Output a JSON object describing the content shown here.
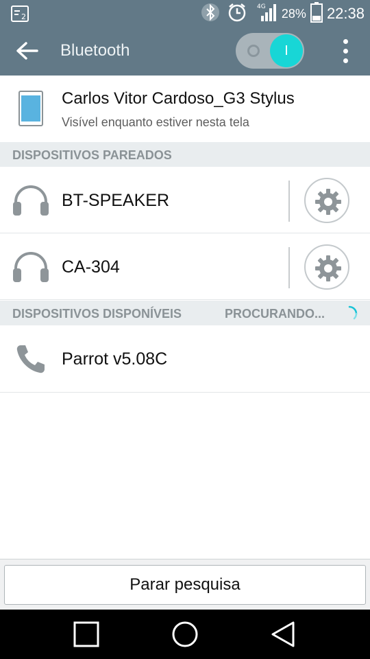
{
  "status_bar": {
    "battery_percent": "28%",
    "time": "22:38",
    "icons": [
      "notification-icon",
      "bluetooth-icon",
      "alarm-icon",
      "signal-icon",
      "battery-icon"
    ]
  },
  "app_bar": {
    "title": "Bluetooth",
    "toggle_on_glyph": "I",
    "toggle_state": "on",
    "accent": "#18d6d6",
    "bar_color": "#627987"
  },
  "this_device": {
    "name": "Carlos Vitor Cardoso_G3 Stylus",
    "subtitle": "Visível enquanto estiver nesta tela"
  },
  "paired_section": {
    "header": "DISPOSITIVOS PAREADOS",
    "items": [
      {
        "label": "BT-SPEAKER",
        "icon": "headphones-icon"
      },
      {
        "label": "CA-304",
        "icon": "headphones-icon"
      }
    ]
  },
  "available_section": {
    "header": "DISPOSITIVOS DISPONÍVEIS",
    "status": "PROCURANDO...",
    "items": [
      {
        "label": "Parrot v5.08C",
        "icon": "phone-call-icon"
      }
    ]
  },
  "bottom": {
    "stop_button": "Parar pesquisa"
  },
  "nav_bar": {
    "buttons": [
      "recent-apps",
      "home",
      "back"
    ]
  }
}
